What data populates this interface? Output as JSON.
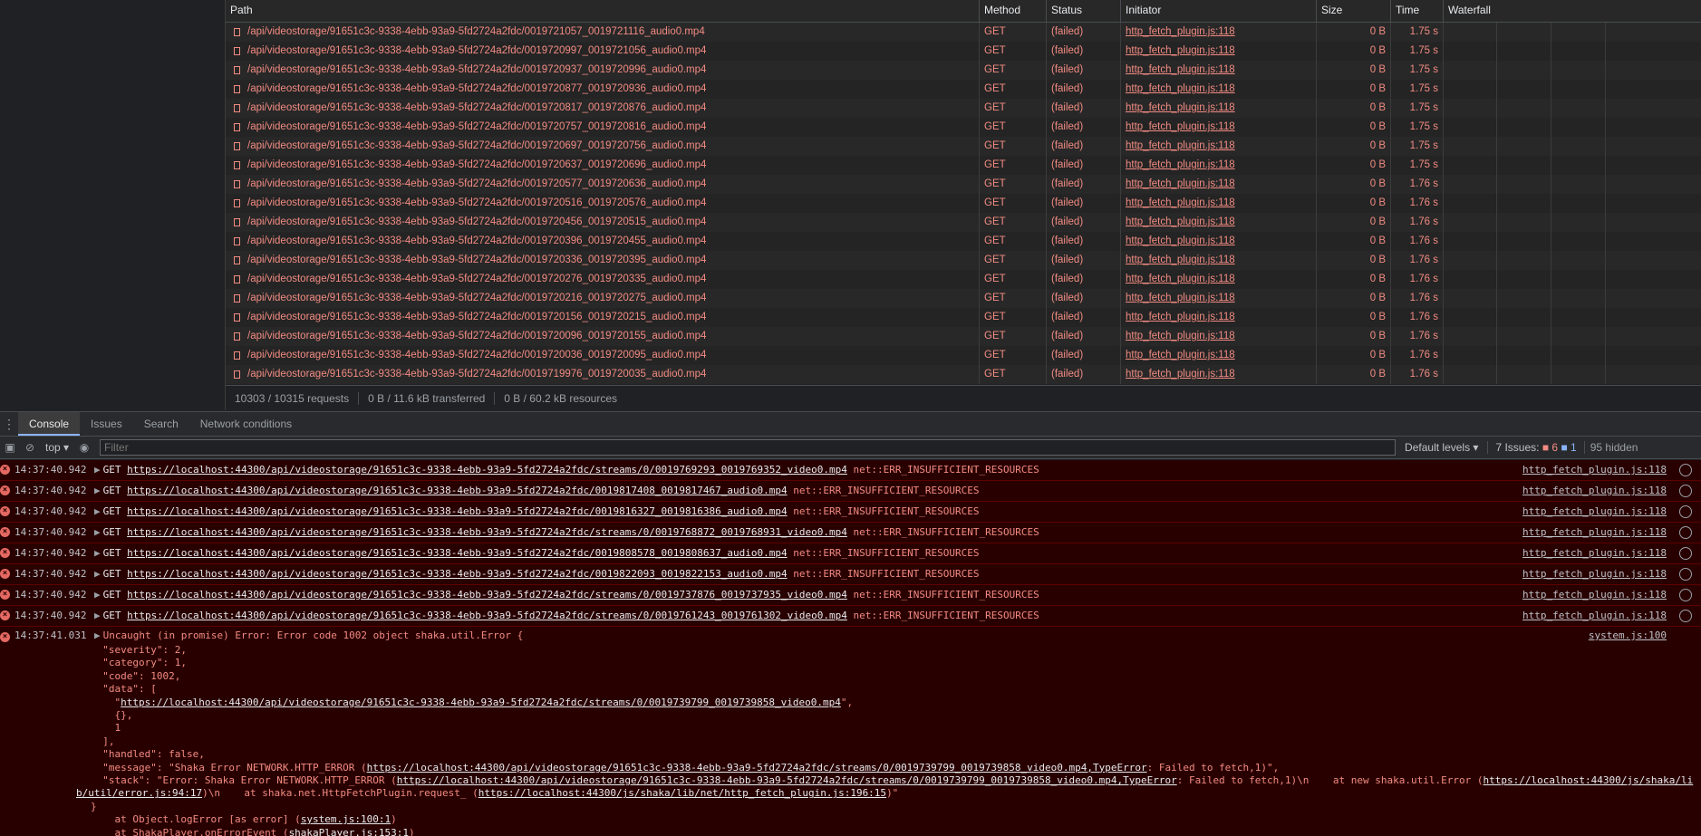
{
  "network": {
    "columns": {
      "path": "Path",
      "method": "Method",
      "status": "Status",
      "initiator": "Initiator",
      "size": "Size",
      "time": "Time",
      "waterfall": "Waterfall"
    },
    "rows": [
      {
        "path": "/api/videostorage/91651c3c-9338-4ebb-93a9-5fd2724a2fdc/0019721057_0019721116_audio0.mp4",
        "method": "GET",
        "status": "(failed)",
        "initiator": "http_fetch_plugin.js:118",
        "size": "0 B",
        "time": "1.75 s"
      },
      {
        "path": "/api/videostorage/91651c3c-9338-4ebb-93a9-5fd2724a2fdc/0019720997_0019721056_audio0.mp4",
        "method": "GET",
        "status": "(failed)",
        "initiator": "http_fetch_plugin.js:118",
        "size": "0 B",
        "time": "1.75 s"
      },
      {
        "path": "/api/videostorage/91651c3c-9338-4ebb-93a9-5fd2724a2fdc/0019720937_0019720996_audio0.mp4",
        "method": "GET",
        "status": "(failed)",
        "initiator": "http_fetch_plugin.js:118",
        "size": "0 B",
        "time": "1.75 s"
      },
      {
        "path": "/api/videostorage/91651c3c-9338-4ebb-93a9-5fd2724a2fdc/0019720877_0019720936_audio0.mp4",
        "method": "GET",
        "status": "(failed)",
        "initiator": "http_fetch_plugin.js:118",
        "size": "0 B",
        "time": "1.75 s"
      },
      {
        "path": "/api/videostorage/91651c3c-9338-4ebb-93a9-5fd2724a2fdc/0019720817_0019720876_audio0.mp4",
        "method": "GET",
        "status": "(failed)",
        "initiator": "http_fetch_plugin.js:118",
        "size": "0 B",
        "time": "1.75 s"
      },
      {
        "path": "/api/videostorage/91651c3c-9338-4ebb-93a9-5fd2724a2fdc/0019720757_0019720816_audio0.mp4",
        "method": "GET",
        "status": "(failed)",
        "initiator": "http_fetch_plugin.js:118",
        "size": "0 B",
        "time": "1.75 s"
      },
      {
        "path": "/api/videostorage/91651c3c-9338-4ebb-93a9-5fd2724a2fdc/0019720697_0019720756_audio0.mp4",
        "method": "GET",
        "status": "(failed)",
        "initiator": "http_fetch_plugin.js:118",
        "size": "0 B",
        "time": "1.75 s"
      },
      {
        "path": "/api/videostorage/91651c3c-9338-4ebb-93a9-5fd2724a2fdc/0019720637_0019720696_audio0.mp4",
        "method": "GET",
        "status": "(failed)",
        "initiator": "http_fetch_plugin.js:118",
        "size": "0 B",
        "time": "1.75 s"
      },
      {
        "path": "/api/videostorage/91651c3c-9338-4ebb-93a9-5fd2724a2fdc/0019720577_0019720636_audio0.mp4",
        "method": "GET",
        "status": "(failed)",
        "initiator": "http_fetch_plugin.js:118",
        "size": "0 B",
        "time": "1.76 s"
      },
      {
        "path": "/api/videostorage/91651c3c-9338-4ebb-93a9-5fd2724a2fdc/0019720516_0019720576_audio0.mp4",
        "method": "GET",
        "status": "(failed)",
        "initiator": "http_fetch_plugin.js:118",
        "size": "0 B",
        "time": "1.76 s"
      },
      {
        "path": "/api/videostorage/91651c3c-9338-4ebb-93a9-5fd2724a2fdc/0019720456_0019720515_audio0.mp4",
        "method": "GET",
        "status": "(failed)",
        "initiator": "http_fetch_plugin.js:118",
        "size": "0 B",
        "time": "1.76 s"
      },
      {
        "path": "/api/videostorage/91651c3c-9338-4ebb-93a9-5fd2724a2fdc/0019720396_0019720455_audio0.mp4",
        "method": "GET",
        "status": "(failed)",
        "initiator": "http_fetch_plugin.js:118",
        "size": "0 B",
        "time": "1.76 s"
      },
      {
        "path": "/api/videostorage/91651c3c-9338-4ebb-93a9-5fd2724a2fdc/0019720336_0019720395_audio0.mp4",
        "method": "GET",
        "status": "(failed)",
        "initiator": "http_fetch_plugin.js:118",
        "size": "0 B",
        "time": "1.76 s"
      },
      {
        "path": "/api/videostorage/91651c3c-9338-4ebb-93a9-5fd2724a2fdc/0019720276_0019720335_audio0.mp4",
        "method": "GET",
        "status": "(failed)",
        "initiator": "http_fetch_plugin.js:118",
        "size": "0 B",
        "time": "1.76 s"
      },
      {
        "path": "/api/videostorage/91651c3c-9338-4ebb-93a9-5fd2724a2fdc/0019720216_0019720275_audio0.mp4",
        "method": "GET",
        "status": "(failed)",
        "initiator": "http_fetch_plugin.js:118",
        "size": "0 B",
        "time": "1.76 s"
      },
      {
        "path": "/api/videostorage/91651c3c-9338-4ebb-93a9-5fd2724a2fdc/0019720156_0019720215_audio0.mp4",
        "method": "GET",
        "status": "(failed)",
        "initiator": "http_fetch_plugin.js:118",
        "size": "0 B",
        "time": "1.76 s"
      },
      {
        "path": "/api/videostorage/91651c3c-9338-4ebb-93a9-5fd2724a2fdc/0019720096_0019720155_audio0.mp4",
        "method": "GET",
        "status": "(failed)",
        "initiator": "http_fetch_plugin.js:118",
        "size": "0 B",
        "time": "1.76 s"
      },
      {
        "path": "/api/videostorage/91651c3c-9338-4ebb-93a9-5fd2724a2fdc/0019720036_0019720095_audio0.mp4",
        "method": "GET",
        "status": "(failed)",
        "initiator": "http_fetch_plugin.js:118",
        "size": "0 B",
        "time": "1.76 s"
      },
      {
        "path": "/api/videostorage/91651c3c-9338-4ebb-93a9-5fd2724a2fdc/0019719976_0019720035_audio0.mp4",
        "method": "GET",
        "status": "(failed)",
        "initiator": "http_fetch_plugin.js:118",
        "size": "0 B",
        "time": "1.76 s"
      }
    ],
    "summary": {
      "requests": "10303 / 10315 requests",
      "transferred": "0 B / 11.6 kB transferred",
      "resources": "0 B / 60.2 kB resources"
    }
  },
  "drawer": {
    "tabs": [
      "Console",
      "Issues",
      "Search",
      "Network conditions"
    ],
    "active_tab": "Console",
    "context": "top",
    "filter_placeholder": "Filter",
    "levels": "Default levels",
    "issues_label": "7 Issues:",
    "issues_errors": "6",
    "issues_info": "1",
    "hidden": "95 hidden"
  },
  "console": {
    "requests": [
      {
        "time": "14:37:40.942",
        "verb": "GET",
        "url": "https://localhost:44300/api/videostorage/91651c3c-9338-4ebb-93a9-5fd2724a2fdc/streams/0/0019769293_0019769352_video0.mp4",
        "error": "net::ERR_INSUFFICIENT_RESOURCES",
        "source": "http_fetch_plugin.js:118"
      },
      {
        "time": "14:37:40.942",
        "verb": "GET",
        "url": "https://localhost:44300/api/videostorage/91651c3c-9338-4ebb-93a9-5fd2724a2fdc/0019817408_0019817467_audio0.mp4",
        "error": "net::ERR_INSUFFICIENT_RESOURCES",
        "source": "http_fetch_plugin.js:118"
      },
      {
        "time": "14:37:40.942",
        "verb": "GET",
        "url": "https://localhost:44300/api/videostorage/91651c3c-9338-4ebb-93a9-5fd2724a2fdc/0019816327_0019816386_audio0.mp4",
        "error": "net::ERR_INSUFFICIENT_RESOURCES",
        "source": "http_fetch_plugin.js:118"
      },
      {
        "time": "14:37:40.942",
        "verb": "GET",
        "url": "https://localhost:44300/api/videostorage/91651c3c-9338-4ebb-93a9-5fd2724a2fdc/streams/0/0019768872_0019768931_video0.mp4",
        "error": "net::ERR_INSUFFICIENT_RESOURCES",
        "source": "http_fetch_plugin.js:118"
      },
      {
        "time": "14:37:40.942",
        "verb": "GET",
        "url": "https://localhost:44300/api/videostorage/91651c3c-9338-4ebb-93a9-5fd2724a2fdc/0019808578_0019808637_audio0.mp4",
        "error": "net::ERR_INSUFFICIENT_RESOURCES",
        "source": "http_fetch_plugin.js:118"
      },
      {
        "time": "14:37:40.942",
        "verb": "GET",
        "url": "https://localhost:44300/api/videostorage/91651c3c-9338-4ebb-93a9-5fd2724a2fdc/0019822093_0019822153_audio0.mp4",
        "error": "net::ERR_INSUFFICIENT_RESOURCES",
        "source": "http_fetch_plugin.js:118"
      },
      {
        "time": "14:37:40.942",
        "verb": "GET",
        "url": "https://localhost:44300/api/videostorage/91651c3c-9338-4ebb-93a9-5fd2724a2fdc/streams/0/0019737876_0019737935_video0.mp4",
        "error": "net::ERR_INSUFFICIENT_RESOURCES",
        "source": "http_fetch_plugin.js:118"
      },
      {
        "time": "14:37:40.942",
        "verb": "GET",
        "url": "https://localhost:44300/api/videostorage/91651c3c-9338-4ebb-93a9-5fd2724a2fdc/streams/0/0019761243_0019761302_video0.mp4",
        "error": "net::ERR_INSUFFICIENT_RESOURCES",
        "source": "http_fetch_plugin.js:118"
      }
    ],
    "uncaught": {
      "time": "14:37:41.031",
      "head": "Uncaught (in promise) Error: Error code 1002 object shaka.util.Error {",
      "source": "system.js:100",
      "l_severity": "\"severity\": 2,",
      "l_category": "\"category\": 1,",
      "l_code": "\"code\": 1002,",
      "l_data": "\"data\": [",
      "data_url": "https://localhost:44300/api/videostorage/91651c3c-9338-4ebb-93a9-5fd2724a2fdc/streams/0/0019739799_0019739858_video0.mp4",
      "l_empty": "{},",
      "l_one": "1",
      "l_close": "],",
      "l_handled": "\"handled\": false,",
      "msg_pre": "\"message\": \"Shaka Error NETWORK.HTTP_ERROR (",
      "msg_url": "https://localhost:44300/api/videostorage/91651c3c-9338-4ebb-93a9-5fd2724a2fdc/streams/0/0019739799_0019739858_video0.mp4,TypeError",
      "msg_post": ": Failed to fetch,1)\",",
      "stack_pre": "\"stack\": \"Error: Shaka Error NETWORK.HTTP_ERROR (",
      "stack_url": "https://localhost:44300/api/videostorage/91651c3c-9338-4ebb-93a9-5fd2724a2fdc/streams/0/0019739799_0019739858_video0.mp4,TypeError",
      "stack_mid": ": Failed to fetch,1)\\n    at new shaka.util.Error (",
      "stack_url2a": "https://localhost:44300/js/shaka/li",
      "stack_url2b": "b/util/error.js:94:17",
      "stack_mid2": ")\\n    at shaka.net.HttpFetchPlugin.request_ (",
      "stack_url3": "https://localhost:44300/js/shaka/lib/net/http_fetch_plugin.js:196:15",
      "stack_end": ")\"",
      "l_brace": "}",
      "at1_pre": "at Object.logError [as error] (",
      "at1_link": "system.js:100:1",
      "at1_post": ")",
      "at2_pre": "at ShakaPlayer.onErrorEvent (",
      "at2_link": "shakaPlayer.js:153:1",
      "at2_post": ")"
    }
  }
}
